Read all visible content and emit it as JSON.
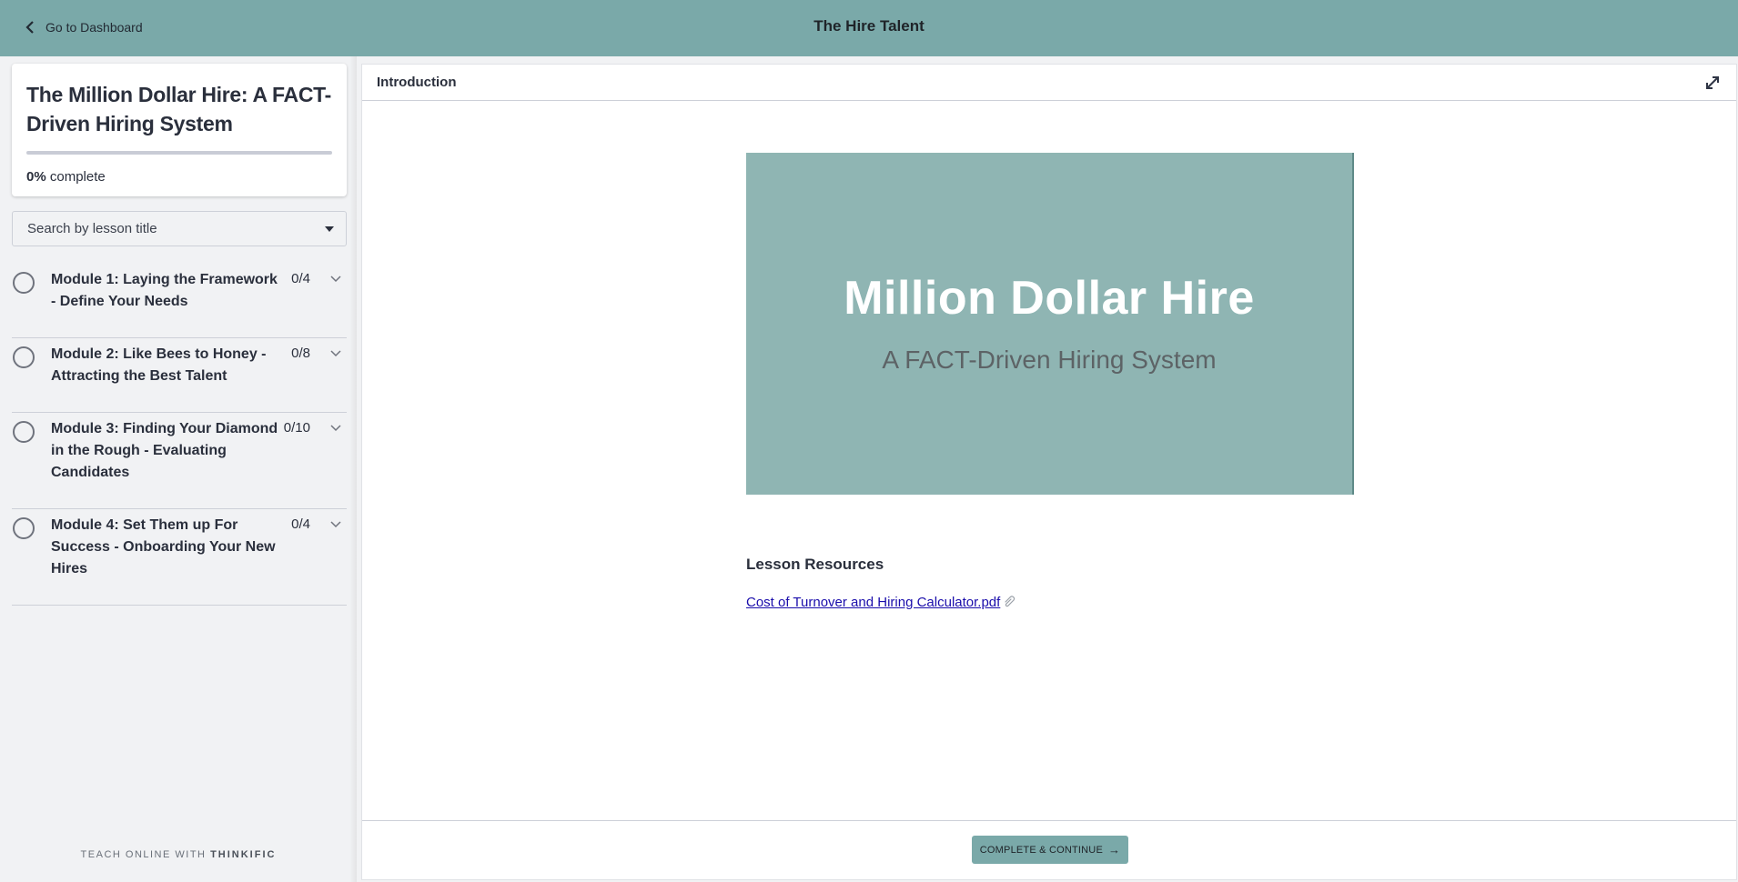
{
  "topbar": {
    "back_label": "Go to Dashboard",
    "site_title": "The Hire Talent",
    "background_color": "#7aa9a9"
  },
  "sidebar": {
    "course_title": "The Million Dollar Hire: A FACT-Driven Hiring System",
    "progress": {
      "percent": 0,
      "percent_label": "0%",
      "suffix": "complete"
    },
    "search": {
      "placeholder": "Search by lesson title"
    },
    "modules": [
      {
        "title": "Module 1: Laying the Framework - Define Your Needs",
        "count": "0/4",
        "completed": false
      },
      {
        "title": "Module 2: Like Bees to Honey - Attracting the Best Talent",
        "count": "0/8",
        "completed": false
      },
      {
        "title": "Module 3: Finding Your Diamond in the Rough - Evaluating Candidates",
        "count": "0/10",
        "completed": false
      },
      {
        "title": "Module 4: Set Them up For Success - Onboarding Your New Hires",
        "count": "0/4",
        "completed": false
      }
    ],
    "branding": {
      "prefix": "TEACH ONLINE WITH ",
      "brand": "THINKIFIC"
    }
  },
  "main": {
    "lesson_title": "Introduction",
    "expand_icon": "expand-icon",
    "slide": {
      "heading": "Million Dollar Hire",
      "subheading": "A FACT-Driven Hiring System",
      "background_color": "#8fb5b3"
    },
    "resources": {
      "title": "Lesson Resources",
      "items": [
        {
          "label": "Cost of Turnover and Hiring Calculator.pdf",
          "icon": "paperclip-icon"
        }
      ]
    },
    "footer": {
      "complete_button_label": "COMPLETE & CONTINUE",
      "complete_button_icon": "arrow-right-icon"
    }
  }
}
